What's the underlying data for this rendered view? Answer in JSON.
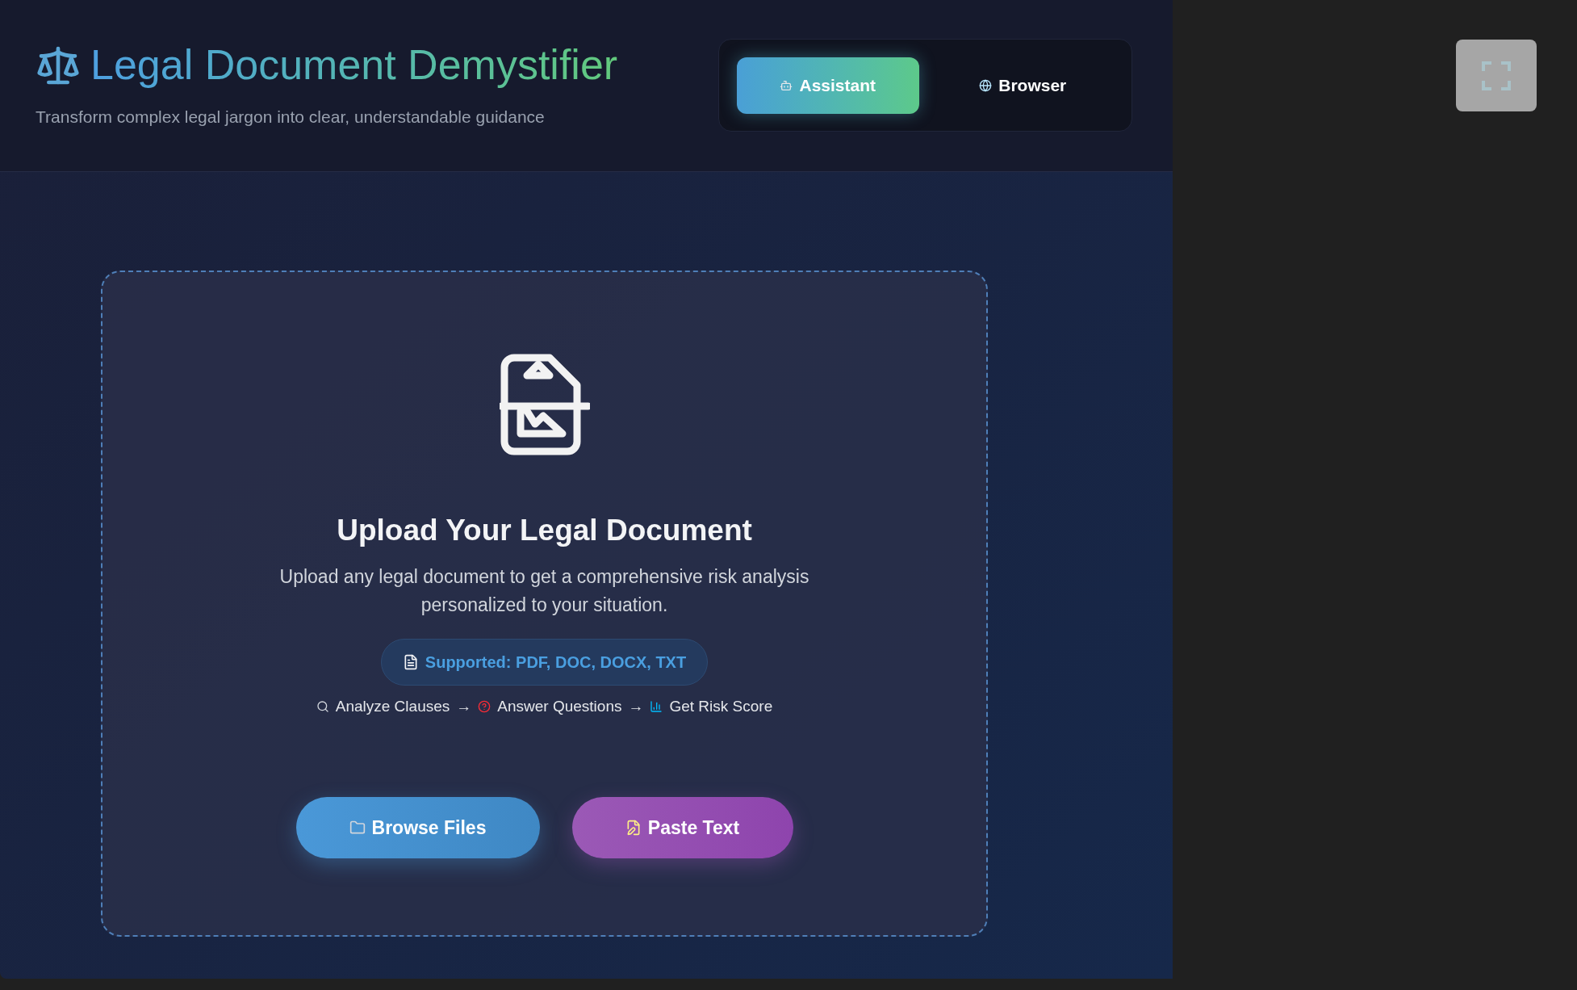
{
  "header": {
    "title": "Legal Document Demystifier",
    "subtitle": "Transform complex legal jargon into clear, understandable guidance"
  },
  "mode_tabs": [
    {
      "kind": "assistant",
      "label": "Assistant",
      "selected": true
    },
    {
      "kind": "browser",
      "label": "Browser",
      "selected": false
    }
  ],
  "upload": {
    "heading": "Upload Your Legal Document",
    "description": "Upload any legal document to get a comprehensive risk analysis personalized to your situation.",
    "supported": "Supported: PDF, DOC, DOCX, TXT",
    "separator": "→",
    "steps": [
      {
        "kind": "search",
        "label": "Analyze Clauses"
      },
      {
        "kind": "question",
        "label": "Answer Questions"
      },
      {
        "kind": "chart",
        "label": "Get Risk Score"
      }
    ],
    "buttons": [
      {
        "kind": "browse",
        "label": "Browse Files"
      },
      {
        "kind": "paste",
        "label": "Paste Text"
      }
    ]
  }
}
